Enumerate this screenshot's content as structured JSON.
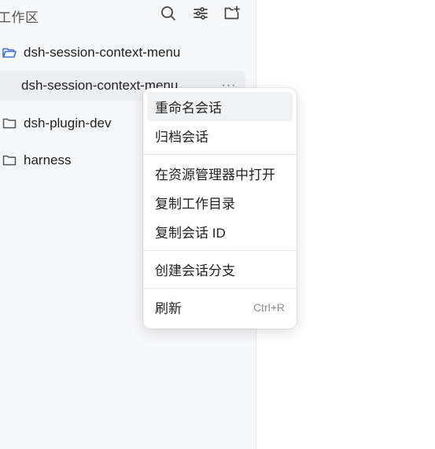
{
  "sidebar": {
    "title": "工作区",
    "icons": {
      "search": "search-icon",
      "filter": "filter-icon",
      "new_folder": "new-folder-icon"
    },
    "items": [
      {
        "label": "dsh-session-context-menu",
        "icon": "folder-open-icon"
      },
      {
        "label": "dsh-plugin-dev",
        "icon": "folder-icon"
      },
      {
        "label": "harness",
        "icon": "folder-icon"
      }
    ],
    "session": {
      "label": "dsh-session-context-menu",
      "more": "···"
    }
  },
  "context_menu": {
    "items": [
      {
        "label": "重命名会话"
      },
      {
        "label": "归档会话"
      },
      {
        "label": "在资源管理器中打开"
      },
      {
        "label": "复制工作目录"
      },
      {
        "label": "复制会话 ID"
      },
      {
        "label": "创建会话分支"
      },
      {
        "label": "刷新",
        "shortcut": "Ctrl+R"
      }
    ]
  },
  "colors": {
    "sidebar_bg": "#f7f8fa",
    "accent_folder": "#3b6fd8",
    "selected_bg": "#eceef1"
  }
}
